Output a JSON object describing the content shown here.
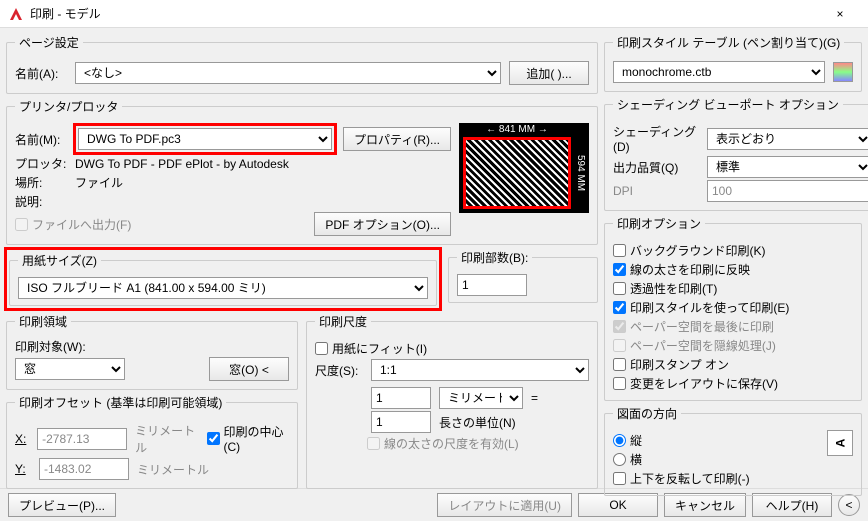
{
  "window": {
    "title": "印刷 - モデル",
    "close": "×"
  },
  "pageSetup": {
    "legend": "ページ設定",
    "nameLabel": "名前(A):",
    "nameValue": "<なし>",
    "addBtn": "追加( )..."
  },
  "printer": {
    "legend": "プリンタ/プロッタ",
    "nameLabel": "名前(M):",
    "nameValue": "DWG To PDF.pc3",
    "propBtn": "プロパティ(R)...",
    "plotterLabel": "プロッタ:",
    "plotterValue": "DWG To PDF - PDF ePlot - by Autodesk",
    "placeLabel": "場所:",
    "placeValue": "ファイル",
    "descLabel": "説明:",
    "descValue": "",
    "fileOut": "ファイルへ出力(F)",
    "pdfOpt": "PDF オプション(O)...",
    "dimW": "← 841 MM →",
    "dimH": "594 MM"
  },
  "paper": {
    "legend": "用紙サイズ(Z)",
    "value": "ISO フルブリード A1 (841.00 x 594.00 ミリ)"
  },
  "copies": {
    "legend": "印刷部数(B):",
    "value": "1"
  },
  "area": {
    "legend": "印刷領域",
    "targetLabel": "印刷対象(W):",
    "targetValue": "窓",
    "windowBtn": "窓(O) <"
  },
  "scale": {
    "legend": "印刷尺度",
    "fitLabel": "用紙にフィット(I)",
    "scaleLabel": "尺度(S):",
    "scaleValue": "1:1",
    "v1": "1",
    "unit": "ミリメートル",
    "eq": "=",
    "v2": "1",
    "lenLabel": "長さの単位(N)",
    "lwLabel": "線の太さの尺度を有効(L)"
  },
  "offset": {
    "legend": "印刷オフセット (基準は印刷可能領域)",
    "xLabel": "X:",
    "xValue": "-2787.13",
    "yLabel": "Y:",
    "yValue": "-1483.02",
    "unit": "ミリメートル",
    "centerLabel": "印刷の中心(C)"
  },
  "styleTable": {
    "legend": "印刷スタイル テーブル (ペン割り当て)(G)",
    "value": "monochrome.ctb"
  },
  "shading": {
    "legend": "シェーディング ビューポート オプション",
    "shadeLabel": "シェーディング(D)",
    "shadeValue": "表示どおり",
    "qualLabel": "出力品質(Q)",
    "qualValue": "標準",
    "dpiLabel": "DPI",
    "dpiValue": "100"
  },
  "options": {
    "legend": "印刷オプション",
    "bg": "バックグラウンド印刷(K)",
    "lw": "線の太さを印刷に反映",
    "trans": "透過性を印刷(T)",
    "style": "印刷スタイルを使って印刷(E)",
    "psLast": "ペーパー空間を最後に印刷",
    "psHide": "ペーパー空間を隠線処理(J)",
    "stamp": "印刷スタンプ オン",
    "save": "変更をレイアウトに保存(V)"
  },
  "orient": {
    "legend": "図面の方向",
    "port": "縦",
    "land": "横",
    "flip": "上下を反転して印刷(-)",
    "icon": "A"
  },
  "footer": {
    "preview": "プレビュー(P)...",
    "apply": "レイアウトに適用(U)",
    "ok": "OK",
    "cancel": "キャンセル",
    "help": "ヘルプ(H)",
    "expand": "<"
  }
}
